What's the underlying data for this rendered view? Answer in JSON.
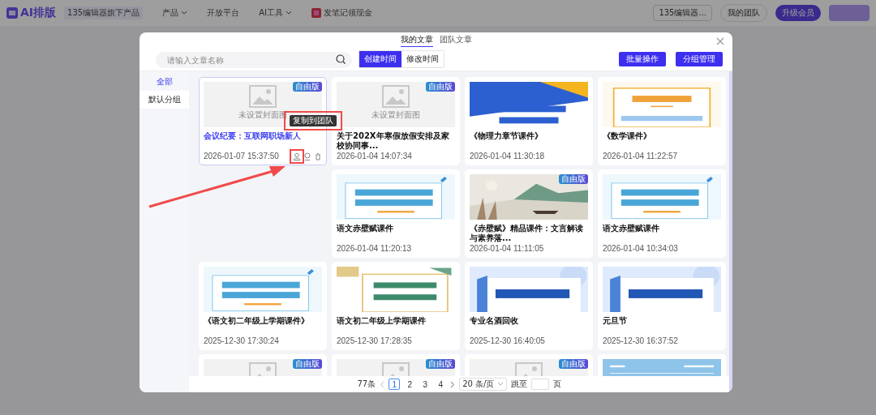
{
  "topbar": {
    "logo": "AI排版",
    "logo_badge": "135编辑器旗下产品",
    "menu": [
      {
        "label": "产品",
        "dropdown": true,
        "icon": false
      },
      {
        "label": "开放平台",
        "dropdown": false,
        "icon": false
      },
      {
        "label": "AI工具",
        "dropdown": true,
        "icon": false
      },
      {
        "label": "发笔记领现金",
        "dropdown": false,
        "icon": true
      }
    ],
    "editor_select": "135编辑器...",
    "team_button": "我的团队",
    "upgrade_button": "升级会员"
  },
  "modal": {
    "tabs": [
      {
        "label": "我的文章",
        "selected": true
      },
      {
        "label": "团队文章",
        "selected": false
      }
    ],
    "search": {
      "placeholder": "请输入文章名称"
    },
    "sort": [
      {
        "label": "创建时间",
        "selected": true
      },
      {
        "label": "修改时间",
        "selected": false
      }
    ],
    "actions": [
      "批量操作",
      "分组管理"
    ],
    "groups": [
      {
        "label": "全部",
        "selected": true
      },
      {
        "label": "默认分组",
        "selected": false
      }
    ],
    "rows": [
      [
        {
          "title": "会议纪要：互联网职场新人",
          "date": "2026-01-07 15:37:50",
          "cover": {
            "kind": "placeholder",
            "text": "未设置封面图"
          },
          "badge": "自由版",
          "selected": true,
          "tooltip": "复制到团队"
        },
        {
          "title": "关于202X年寒假放假安排及家校协同事...",
          "date": "2026-01-04 14:07:34",
          "cover": {
            "kind": "placeholder",
            "text": "未设置封面图"
          },
          "badge": "自由版",
          "selected": false
        },
        {
          "title": "《物理力章节课件》",
          "date": "2026-01-04 11:30:18",
          "selected": false
        },
        {
          "title": "《数学课件》",
          "date": "2026-01-04 11:22:57",
          "selected": false
        }
      ],
      [
        null,
        {
          "title": "语文赤壁赋课件",
          "date": "2026-01-04 11:20:13",
          "selected": false
        },
        {
          "title": "《赤壁赋》精品课件：文言解读与素养落...",
          "date": "2026-01-04 11:11:05",
          "badge": "自由版",
          "selected": false
        },
        {
          "title": "语文赤壁赋课件",
          "date": "2026-01-04 10:34:03",
          "selected": false
        }
      ],
      [
        {
          "title": "《语文初二年级上学期课件》",
          "date": "2025-12-30 17:30:24",
          "selected": false
        },
        {
          "title": "语文初二年级上学期课件",
          "date": "2025-12-30 17:28:35",
          "selected": false
        },
        {
          "title": "专业名酒回收",
          "date": "2025-12-30 16:40:05",
          "selected": false
        },
        {
          "title": "元旦节",
          "date": "2025-12-30 16:37:52",
          "selected": false
        }
      ],
      [
        {
          "cover": {
            "kind": "placeholder"
          },
          "badge": "自由版",
          "selected": false
        },
        {
          "cover": {
            "kind": "placeholder"
          },
          "badge": "自由版",
          "selected": false
        },
        {
          "cover": {
            "kind": "placeholder"
          },
          "badge": "自由版",
          "selected": false
        },
        {
          "selected": false
        }
      ]
    ],
    "pagination": {
      "total": "77条",
      "pages": [
        {
          "label": "1",
          "selected": true
        },
        {
          "label": "2",
          "selected": false
        },
        {
          "label": "3",
          "selected": false
        },
        {
          "label": "4",
          "selected": false
        }
      ],
      "page_size": "20 条/页",
      "jump_label": "跳至",
      "jump_suffix": "页"
    }
  },
  "annotations": [
    {
      "kind": "highlight-box"
    },
    {
      "kind": "highlight-box"
    },
    {
      "kind": "arrow"
    }
  ]
}
